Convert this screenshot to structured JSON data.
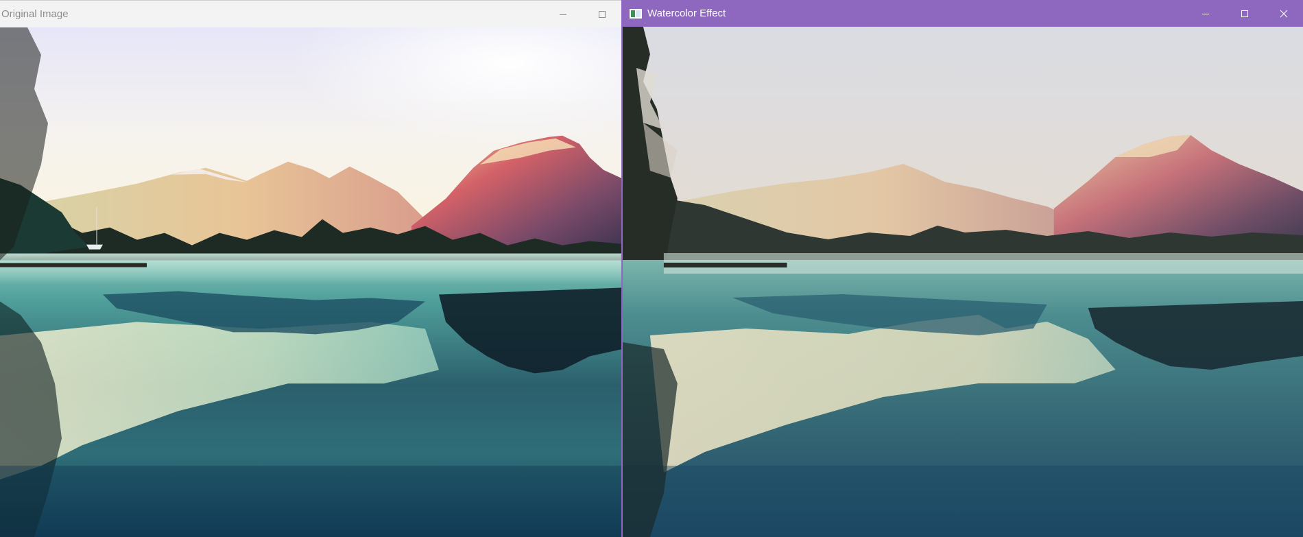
{
  "left_window": {
    "title": "Original Image",
    "controls": {
      "minimize_icon": "minimize-icon",
      "maximize_icon": "maximize-icon"
    },
    "image_subject": "lake-mountains-landscape"
  },
  "right_window": {
    "title": "Watercolor Effect",
    "app_icon": "opencv-window-icon",
    "controls": {
      "minimize_icon": "minimize-icon",
      "maximize_icon": "maximize-icon",
      "close_icon": "close-icon"
    },
    "image_subject": "lake-mountains-watercolor"
  },
  "colors": {
    "active_titlebar": "#8e67bf",
    "inactive_titlebar": "#f3f3f3",
    "inactive_title_text": "#8c8c8c",
    "active_title_text": "#ffffff"
  }
}
